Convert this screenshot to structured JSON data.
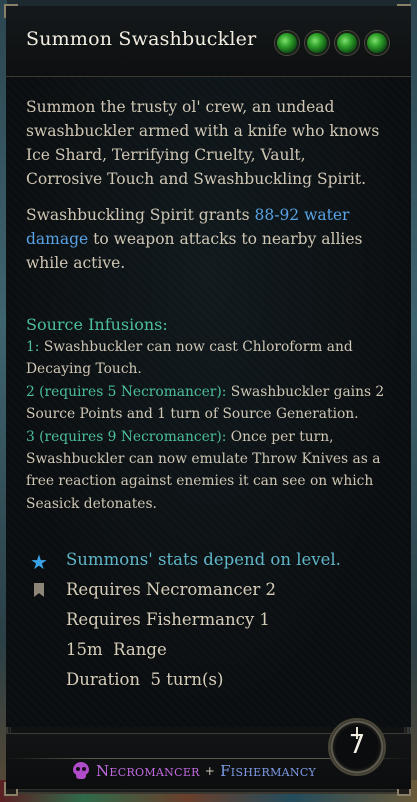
{
  "tooltip": {
    "title": "Summon Swashbuckler",
    "action_points": 4,
    "description_1": "Summon the trusty ol' crew, an undead swashbuckler armed with a knife who knows Ice Shard, Terrifying Cruelty, Vault, Corrosive Touch and Swashbuckling Spirit.",
    "description_2_pre": "Swashbuckling Spirit grants ",
    "description_2_highlight": "88-92 water damage",
    "description_2_post": " to weapon attacks to nearby allies while active.",
    "infusions_heading": "Source Infusions:",
    "infusions": [
      {
        "label": "1:",
        "text": " Swashbuckler can now cast Chloroform and Decaying Touch."
      },
      {
        "label": "2 (requires 5 Necromancer):",
        "text": " Swashbuckler gains 2 Source Points and 1 turn of Source Generation."
      },
      {
        "label": "3 (requires 9 Necromancer):",
        "text": " Once per turn, Swashbuckler can now emulate Throw Knives as a free reaction against enemies it can see on which Seasick detonates."
      }
    ],
    "note": "Summons' stats depend on level.",
    "requirements": [
      "Requires Necromancer 2",
      "Requires Fishermancy 1"
    ],
    "range": "15m  Range",
    "duration": "Duration  5 turn(s)",
    "schools": {
      "primary": "Necromancer",
      "plus": "+",
      "secondary": "Fishermancy"
    },
    "cooldown": "7",
    "colors": {
      "highlight_blue": "#58a3e6",
      "infusion_green": "#4bbf9c",
      "necro_purple": "#c06be0",
      "fish_blue": "#7f9ce8"
    },
    "icons": {
      "note": "star-icon",
      "requirement": "bookmark-icon",
      "school": "skull-icon"
    }
  }
}
